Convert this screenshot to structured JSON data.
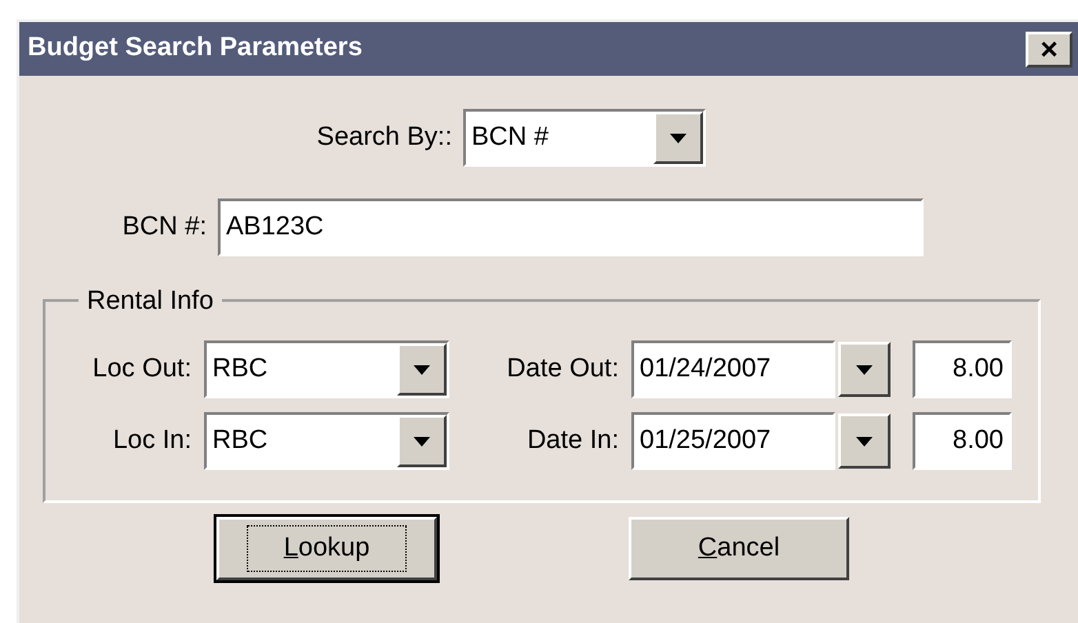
{
  "window": {
    "title": "Budget Search Parameters",
    "close": "×"
  },
  "search_by": {
    "label": "Search By::",
    "value": "BCN #"
  },
  "bcn": {
    "label": "BCN #:",
    "value": "AB123C"
  },
  "rental_info": {
    "title": "Rental Info",
    "rows": [
      {
        "loc_label": "Loc Out:",
        "loc_value": "RBC",
        "date_label": "Date Out:",
        "date_value": "01/24/2007",
        "hours": "8.00"
      },
      {
        "loc_label": "Loc In:",
        "loc_value": "RBC",
        "date_label": "Date In:",
        "date_value": "01/25/2007",
        "hours": "8.00"
      }
    ]
  },
  "buttons": [
    {
      "mnemonic": "L",
      "rest": "ookup",
      "default": true
    },
    {
      "mnemonic": "C",
      "rest": "ancel",
      "default": false
    }
  ]
}
